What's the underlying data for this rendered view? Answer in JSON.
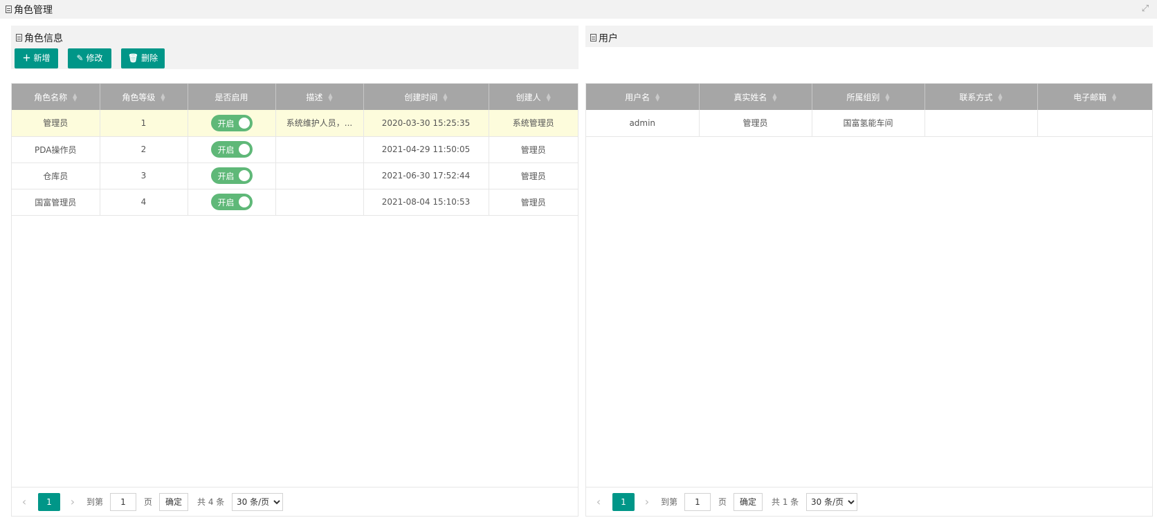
{
  "page": {
    "title": "角色管理"
  },
  "roles_panel": {
    "title": "角色信息",
    "toolbar": {
      "add_label": "新增",
      "edit_label": "修改",
      "delete_label": "删除"
    },
    "columns": [
      "角色名称",
      "角色等级",
      "是否启用",
      "描述",
      "创建时间",
      "创建人"
    ],
    "rows": [
      {
        "name": "管理员",
        "level": "1",
        "enabled": "开启",
        "desc": "系统维护人员，...",
        "created": "2020-03-30 15:25:35",
        "creator": "系统管理员"
      },
      {
        "name": "PDA操作员",
        "level": "2",
        "enabled": "开启",
        "desc": "",
        "created": "2021-04-29 11:50:05",
        "creator": "管理员"
      },
      {
        "name": "仓库员",
        "level": "3",
        "enabled": "开启",
        "desc": "",
        "created": "2021-06-30 17:52:44",
        "creator": "管理员"
      },
      {
        "name": "国富管理员",
        "level": "4",
        "enabled": "开启",
        "desc": "",
        "created": "2021-08-04 15:10:53",
        "creator": "管理员"
      }
    ],
    "pager": {
      "current": "1",
      "goto_label": "到第",
      "page_value": "1",
      "page_unit": "页",
      "confirm_label": "确定",
      "total_label": "共 4 条",
      "page_size": "30 条/页"
    }
  },
  "users_panel": {
    "title": "用户",
    "columns": [
      "用户名",
      "真实姓名",
      "所属组别",
      "联系方式",
      "电子邮箱"
    ],
    "rows": [
      {
        "username": "admin",
        "realname": "管理员",
        "group": "国富氢能车间",
        "contact": "",
        "email": ""
      }
    ],
    "pager": {
      "current": "1",
      "goto_label": "到第",
      "page_value": "1",
      "page_unit": "页",
      "confirm_label": "确定",
      "total_label": "共 1 条",
      "page_size": "30 条/页"
    }
  },
  "colors": {
    "accent": "#009688",
    "switch_on": "#5fb878",
    "header_bg": "#a6a6a6",
    "selected_row": "#fdfcdc"
  }
}
